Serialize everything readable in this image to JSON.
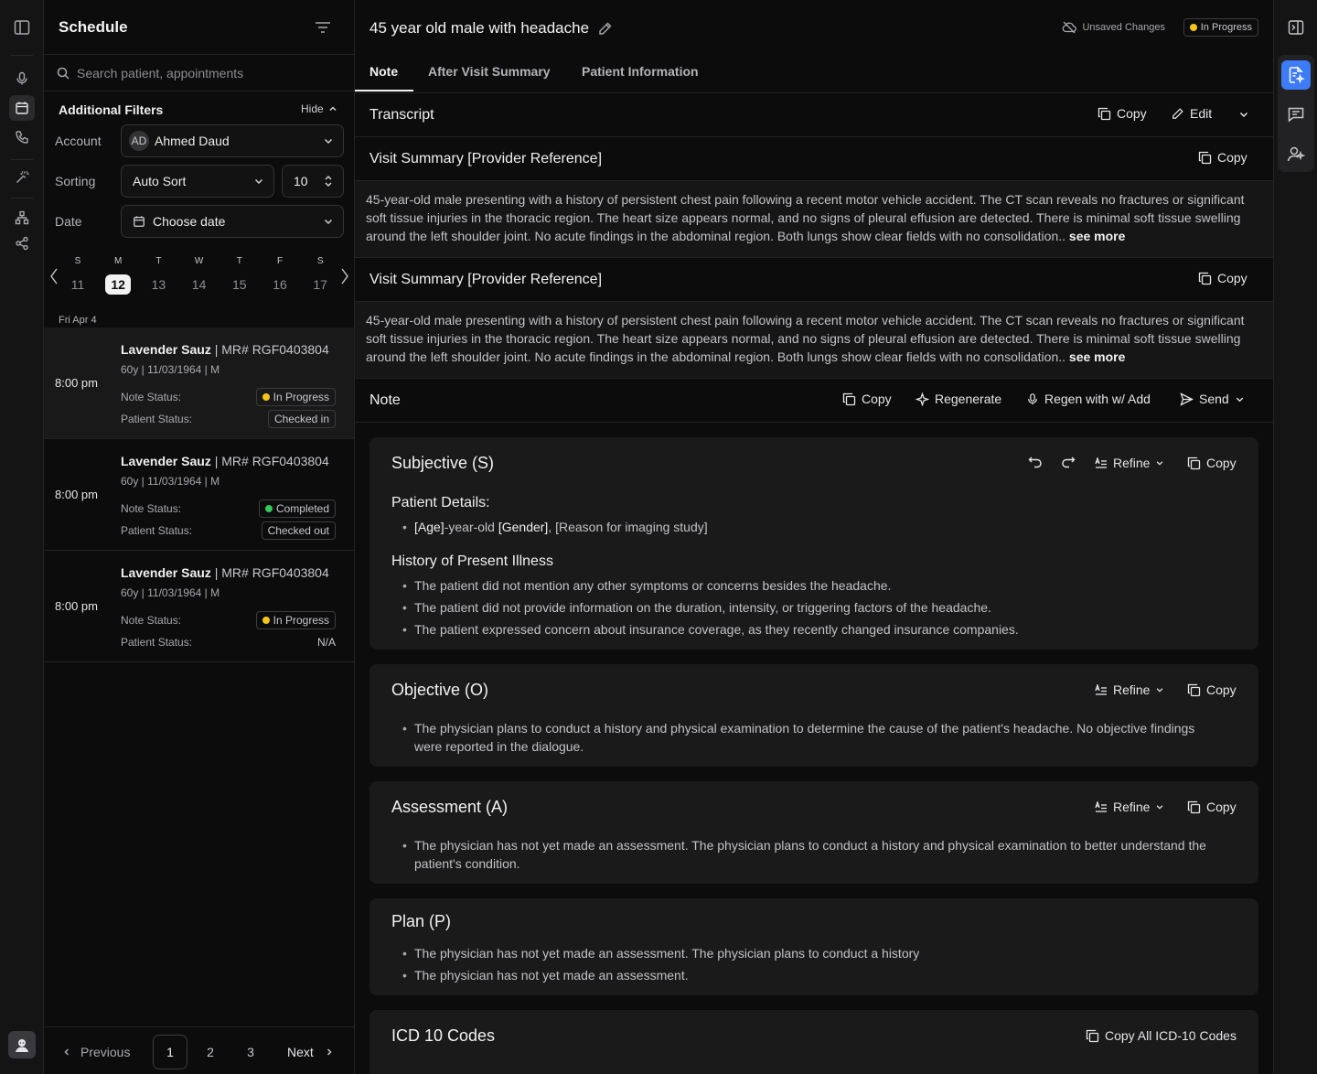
{
  "schedule": {
    "title": "Schedule",
    "search_placeholder": "Search patient, appointments",
    "filters_title": "Additional Filters",
    "hide_label": "Hide",
    "account_label": "Account",
    "account_initials": "AD",
    "account_value": "Ahmed Daud",
    "sorting_label": "Sorting",
    "sorting_value": "Auto Sort",
    "count_value": "10",
    "date_label": "Date",
    "date_placeholder": "Choose date",
    "week": [
      {
        "letter": "S",
        "num": "11"
      },
      {
        "letter": "M",
        "num": "12"
      },
      {
        "letter": "T",
        "num": "13"
      },
      {
        "letter": "W",
        "num": "14"
      },
      {
        "letter": "T",
        "num": "15"
      },
      {
        "letter": "F",
        "num": "16"
      },
      {
        "letter": "S",
        "num": "17"
      }
    ],
    "selected_day": "12",
    "group_date": "Fri Apr 4",
    "appointments": [
      {
        "time": "8:00 pm",
        "name": "Lavender Sauz",
        "mr": " | MR# RGF0403804",
        "sub": "60y | 11/03/1964 | M",
        "note_label": "Note Status:",
        "note_status": "In Progress",
        "note_color": "#f5c518",
        "patient_label": "Patient Status:",
        "patient_status": "Checked in"
      },
      {
        "time": "8:00 pm",
        "name": "Lavender Sauz",
        "mr": " | MR# RGF0403804",
        "sub": "60y | 11/03/1964 | M",
        "note_label": "Note Status:",
        "note_status": "Completed",
        "note_color": "#34c759",
        "patient_label": "Patient Status:",
        "patient_status": "Checked out"
      },
      {
        "time": "8:00 pm",
        "name": "Lavender Sauz",
        "mr": " | MR# RGF0403804",
        "sub": "60y | 11/03/1964 | M",
        "note_label": "Note Status:",
        "note_status": "In Progress",
        "note_color": "#f5c518",
        "patient_label": "Patient Status:",
        "patient_status": "N/A"
      }
    ],
    "pager": {
      "prev": "Previous",
      "pages": [
        "1",
        "2",
        "3"
      ],
      "current": "1",
      "next": "Next"
    }
  },
  "main": {
    "title": "45 year old male with headache",
    "unsaved": "Unsaved Changes",
    "status": "In Progress",
    "status_color": "#f5c518",
    "tabs": [
      "Note",
      "After Visit Summary",
      "Patient Information"
    ],
    "transcript": {
      "title": "Transcript",
      "copy": "Copy",
      "edit": "Edit"
    },
    "summaries": [
      {
        "title": "Visit Summary [Provider Reference]",
        "copy": "Copy",
        "text": "45-year-old male presenting with a history of persistent chest pain following a recent motor vehicle accident. The CT scan reveals no fractures or significant soft tissue injuries in the thoracic region. The heart size appears normal, and no signs of pleural effusion are detected. There is minimal soft tissue swelling around the left shoulder joint. No acute findings in the abdominal region. Both lungs show clear fields with no consolidation..",
        "more": "see more"
      },
      {
        "title": "Visit Summary [Provider Reference]",
        "copy": "Copy",
        "text": "45-year-old male presenting with a history of persistent chest pain following a recent motor vehicle accident. The CT scan reveals no fractures or significant soft tissue injuries in the thoracic region. The heart size appears normal, and no signs of pleural effusion are detected. There is minimal soft tissue swelling around the left shoulder joint. No acute findings in the abdominal region. Both lungs show clear fields with no consolidation..",
        "more": "see more"
      }
    ],
    "note": {
      "title": "Note",
      "copy": "Copy",
      "regenerate": "Regenerate",
      "regen_add": "Regen with w/ Add",
      "send": "Send"
    },
    "sections": {
      "refine": "Refine",
      "copy": "Copy",
      "subjective": {
        "title": "Subjective (S)",
        "patient_details": "Patient Details:",
        "pd_age": "[Age]",
        "pd_mid": "-year-old ",
        "pd_gender": "[Gender]",
        "pd_reason": ", [Reason for imaging study]",
        "hpi": "History of Present Illness",
        "hpi_items": [
          "The patient did not mention any other symptoms or concerns besides the headache.",
          "The patient did not provide information on the duration, intensity, or triggering factors of the headache.",
          "The patient expressed concern about insurance coverage, as they recently changed insurance companies."
        ]
      },
      "objective": {
        "title": "Objective (O)",
        "items": [
          "The physician plans to conduct a history and physical examination to determine the cause of the patient's headache. No objective findings were reported in the dialogue."
        ]
      },
      "assessment": {
        "title": "Assessment (A)",
        "items": [
          "The physician has not yet made an assessment. The physician plans to conduct a history and physical examination to better understand the patient's condition."
        ]
      },
      "plan": {
        "title": "Plan (P)",
        "items": [
          "The physician has not yet made an assessment. The physician plans to conduct a history",
          "The physician has not yet made an assessment."
        ]
      },
      "icd": {
        "title": "ICD 10 Codes",
        "copy_all": "Copy All ICD-10 Codes"
      }
    }
  },
  "icons": {
    "rail": [
      "sidebar-toggle-icon",
      "microphone-icon",
      "calendar-icon",
      "phone-icon",
      "magic-wand-icon",
      "hierarchy-icon",
      "share-icon",
      "user-avatar-icon"
    ],
    "right_rail": [
      "panel-collapse-icon",
      "document-ai-icon",
      "chat-icon",
      "assistant-icon"
    ]
  }
}
